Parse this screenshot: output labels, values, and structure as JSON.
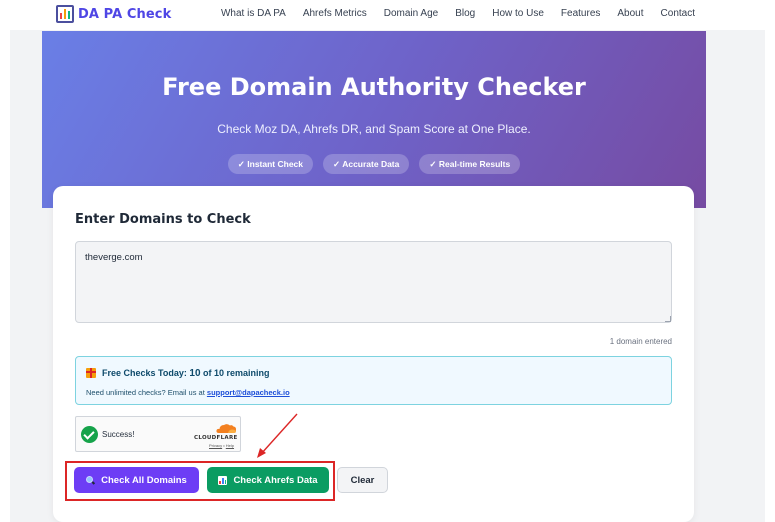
{
  "nav": {
    "logo_text": "DA PA Check",
    "links": [
      "What is DA PA",
      "Ahrefs Metrics",
      "Domain Age",
      "Blog",
      "How to Use",
      "Features",
      "About",
      "Contact"
    ]
  },
  "hero": {
    "title": "Free Domain Authority Checker",
    "subtitle": "Check Moz DA, Ahrefs DR, and Spam Score at One Place.",
    "pills": [
      "✓ Instant Check",
      "✓ Accurate Data",
      "✓ Real-time Results"
    ]
  },
  "form": {
    "title": "Enter Domains to Check",
    "input_value": "theverge.com",
    "domain_count": "1 domain entered"
  },
  "quota": {
    "label": "Free Checks Today:",
    "count": "10",
    "suffix": "of 10 remaining",
    "note": "Need unlimited checks? Email us at",
    "email": "support@dapacheck.io"
  },
  "captcha": {
    "status": "Success!",
    "brand": "CLOUDFLARE",
    "privacy": "Privacy",
    "separator": "•",
    "help": "Help"
  },
  "buttons": {
    "check_all": "Check All Domains",
    "ahrefs": "Check Ahrefs Data",
    "clear": "Clear"
  },
  "colors": {
    "brand": "#4f46e5",
    "primary_button": "#6d3df5",
    "ahrefs_button": "#0a9c62",
    "highlight": "#dc2626"
  }
}
